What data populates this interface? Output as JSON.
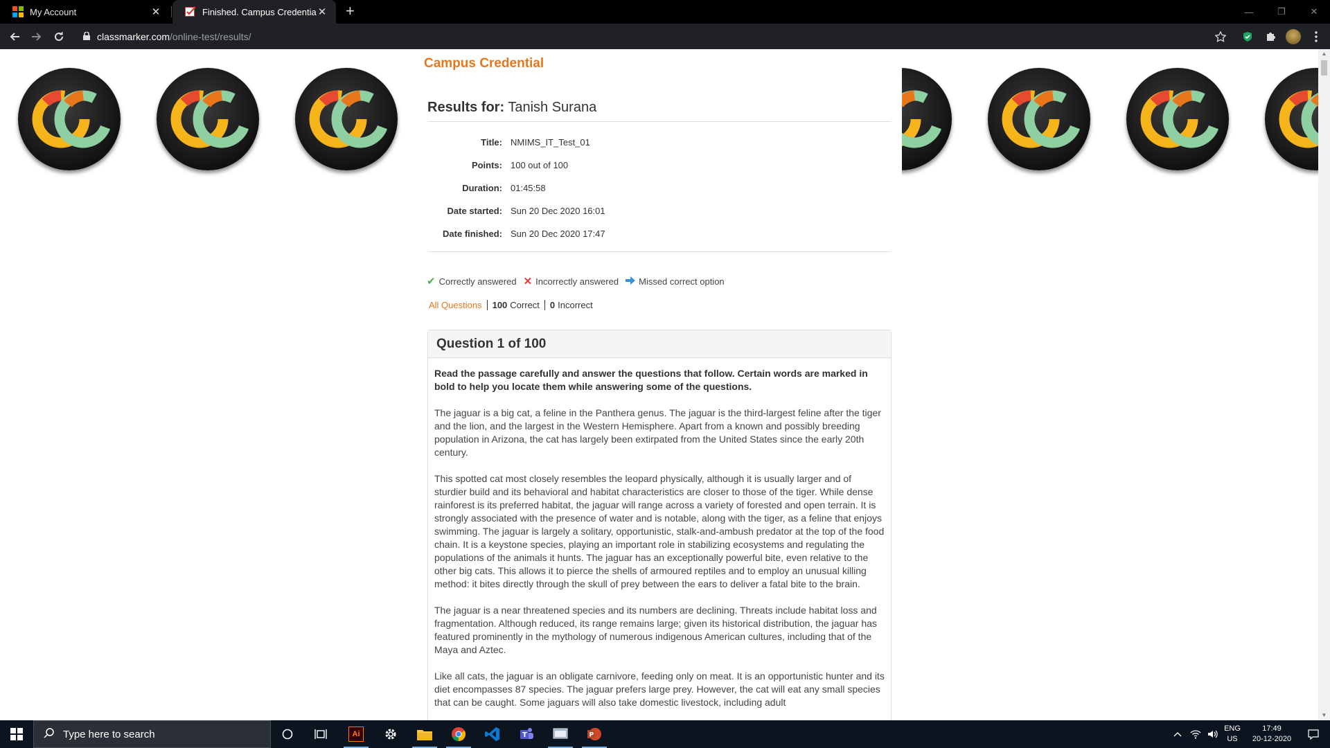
{
  "browser": {
    "tabs": [
      {
        "title": "My Account",
        "favicon": "microsoft-icon"
      },
      {
        "title": "Finished. Campus Credential",
        "favicon": "classmarker-check-icon"
      }
    ],
    "url_host": "classmarker.com",
    "url_path": "/online-test/results/"
  },
  "page": {
    "brand": "Campus Credential",
    "results_label": "Results for:",
    "student_name": "Tanish Surana",
    "details": [
      {
        "label": "Title:",
        "value": "NMIMS_IT_Test_01"
      },
      {
        "label": "Points:",
        "value": "100 out of 100"
      },
      {
        "label": "Duration:",
        "value": "01:45:58"
      },
      {
        "label": "Date started:",
        "value": "Sun 20 Dec 2020 16:01"
      },
      {
        "label": "Date finished:",
        "value": "Sun 20 Dec 2020 17:47"
      }
    ],
    "legend": {
      "correct": "Correctly answered",
      "incorrect": "Incorrectly answered",
      "missed": "Missed correct option"
    },
    "filters": {
      "all": "All Questions",
      "correct_count": "100",
      "correct_label": "Correct",
      "incorrect_count": "0",
      "incorrect_label": "Incorrect"
    },
    "question": {
      "heading": "Question 1 of 100",
      "lead": "Read the passage carefully and answer the questions that follow. Certain words are marked in bold to help you locate them while answering some of the questions.",
      "paragraphs": [
        "The jaguar is a big cat, a feline in the Panthera genus. The jaguar is the third-largest feline after the tiger and the lion, and the largest in the Western Hemisphere. Apart from a known and possibly breeding population in Arizona, the cat has largely been extirpated from the United States since the early 20th century.",
        "This spotted cat most closely resembles the leopard physically, although it is usually larger and of sturdier build and its behavioral and habitat characteristics are closer to those of the tiger. While dense rainforest is its preferred habitat, the jaguar will range across a variety of forested and open terrain. It is strongly associated with the presence of water and is notable, along with the tiger, as a feline that enjoys swimming. The jaguar is largely a solitary, opportunistic, stalk-and-ambush predator at the top of the food chain. It is a keystone species, playing an important role in stabilizing ecosystems and regulating the populations of the animals it hunts. The jaguar has an exceptionally powerful bite, even relative to the other big cats. This allows it to pierce the shells of armoured reptiles and to employ an unusual killing method: it bites directly through the skull of prey between the ears to deliver a fatal bite to the brain.",
        "The jaguar is a near threatened species and its numbers are declining. Threats include habitat loss and fragmentation. Although reduced, its range remains large; given its historical distribution, the jaguar has featured prominently in the mythology of numerous indigenous American cultures, including that of the Maya and Aztec.",
        "Like all cats, the jaguar is an obligate carnivore, feeding only on meat. It is an opportunistic hunter and its diet encompasses 87 species. The jaguar prefers large prey. However, the cat will eat any small species that can be caught. Some jaguars will also take domestic livestock, including adult"
      ]
    }
  },
  "taskbar": {
    "search_placeholder": "Type here to search",
    "lang": "ENG",
    "region": "US",
    "time": "17:49",
    "date": "20-12-2020"
  },
  "colors": {
    "brand_orange": "#e8761b",
    "check_green": "#4caf50",
    "cross_red": "#e53935",
    "arrow_blue": "#3d8fe0"
  }
}
